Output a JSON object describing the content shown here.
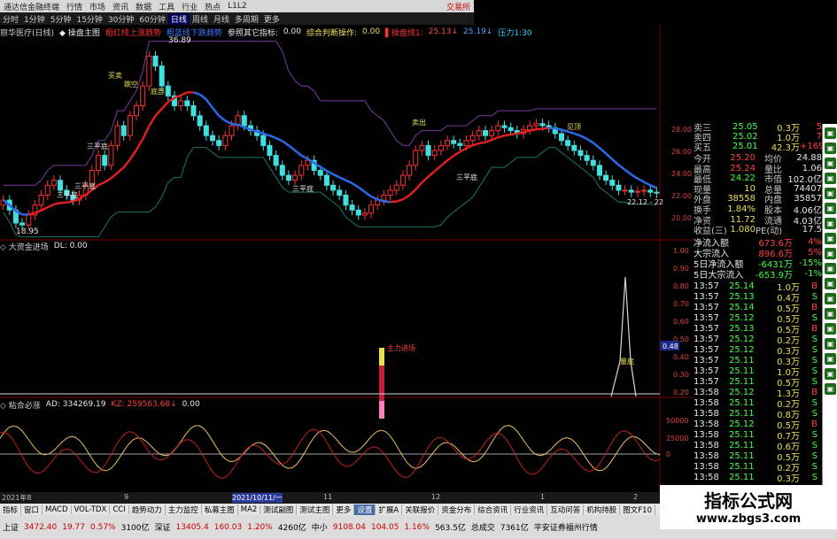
{
  "titlebar": {
    "title": "通达信金融终端",
    "menus": [
      "行情",
      "市场",
      "资讯",
      "数据",
      "工具",
      "行业",
      "热点",
      "L1L2"
    ],
    "right_label": "交易所"
  },
  "periodbar": {
    "items": [
      "分时",
      "1分钟",
      "5分钟",
      "15分钟",
      "30分钟",
      "60分钟",
      "日线",
      "周线",
      "月线",
      "多周期",
      "更多"
    ],
    "active": "日线"
  },
  "main_info": {
    "items": [
      {
        "text": "丽华医疗(日线)",
        "color": "#cfcfcf"
      },
      {
        "text": "◆ 操盘主图",
        "color": "#e8e8e8"
      },
      {
        "text": "粗红线上涨趋势",
        "color": "#ff3030"
      },
      {
        "text": "粗蓝线下跌趋势",
        "color": "#3a7cff"
      },
      {
        "text": "参照其它指标:",
        "color": "#e8e8e8"
      },
      {
        "text": "0.00",
        "color": "#e8e8e8"
      },
      {
        "text": "综合判断操作:",
        "color": "#e8e060"
      },
      {
        "text": "0.00",
        "color": "#e8e060"
      },
      {
        "text": "▌操盘线1:",
        "color": "#ff3030"
      },
      {
        "text": "25.13↓",
        "color": "#ff5050"
      },
      {
        "text": "25.19↓",
        "color": "#50a0ff"
      },
      {
        "text": "压力1:30",
        "color": "#30d0ff"
      }
    ]
  },
  "main_labels": {
    "high_price": "36.89",
    "low_price": "18.95",
    "right_note": "22.12 - 22"
  },
  "main_markers": [
    "三平底",
    "三平底",
    "三平底",
    "三平底",
    "三平底",
    "买卖",
    "跳空",
    "底部",
    "卖出",
    "见顶"
  ],
  "panel2_info": {
    "items": [
      {
        "text": "◇ 大资金进场",
        "color": "#cfcfcf"
      },
      {
        "text": "DL: 0.00",
        "color": "#e8e8e8"
      }
    ]
  },
  "panel2_labels": [
    "主力进场",
    "量底"
  ],
  "panel3_info": {
    "items": [
      {
        "text": "◇ 粘合必涨",
        "color": "#cfcfcf"
      },
      {
        "text": "AD: 334269.19",
        "color": "#e8e8e8"
      },
      {
        "text": "KZ: 259563.68↓",
        "color": "#ff4040"
      },
      {
        "text": "0.00",
        "color": "#e8e8e8"
      }
    ]
  },
  "axes": {
    "main": [
      "28.00",
      "26.00",
      "24.00",
      "22.00",
      "20.00"
    ],
    "panel2": [
      "1.00",
      "0.90",
      "0.80",
      "0.70",
      "0.60",
      "0.50",
      "0.40",
      "0.30",
      "0.20"
    ],
    "panel2_highlight": "0.48",
    "panel3": [
      "50000",
      "25000",
      "0"
    ]
  },
  "datebar": {
    "items": [
      "2021年8",
      "9",
      "2021/10/11/一",
      "11",
      "12",
      "1",
      "2"
    ]
  },
  "quote": {
    "asks": [
      {
        "label": "卖三",
        "price": "25.05",
        "vol": "0.3万",
        "flag": "5"
      },
      {
        "label": "卖四",
        "price": "25.02",
        "vol": "1.0万",
        "flag": "7"
      },
      {
        "label": "买五",
        "price": "25.01",
        "vol": "42.3万",
        "flag": "+169"
      }
    ],
    "stats": [
      {
        "k1": "今开",
        "v1": "25.20",
        "k2": "均价",
        "v2": "24.88"
      },
      {
        "k1": "最高",
        "v1": "25.24",
        "k2": "量比",
        "v2": "1.06"
      },
      {
        "k1": "最低",
        "v1": "24.22",
        "k2": "市值",
        "v2": "102.0亿"
      },
      {
        "k1": "现量",
        "v1": "10",
        "k2": "总量",
        "v2": "74407"
      },
      {
        "k1": "外盘",
        "v1": "38558",
        "k2": "内盘",
        "v2": "35857"
      },
      {
        "k1": "换手",
        "v1": "1.84%",
        "k2": "股本",
        "v2": "4.06亿"
      },
      {
        "k1": "净资",
        "v1": "11.72",
        "k2": "流通",
        "v2": "4.03亿"
      },
      {
        "k1": "收益(三)",
        "v1": "1.080",
        "k2": "PE(动)",
        "v2": "17.5"
      }
    ],
    "flows": [
      {
        "label": "净流入额",
        "value": "673.6万",
        "pct": "4%",
        "color": "#ff4040"
      },
      {
        "label": "大宗流入",
        "value": "896.6万",
        "pct": "5%",
        "color": "#ff4040"
      },
      {
        "label": "5日净流入额",
        "value": "-6431万",
        "pct": "-15%",
        "color": "#40ff40"
      },
      {
        "label": "5日大宗流入",
        "value": "-653.9万",
        "pct": "-1%",
        "color": "#40ff40"
      }
    ],
    "ticks": [
      {
        "t": "13:57",
        "p": "25.14",
        "v": "1.0万",
        "s": "B"
      },
      {
        "t": "13:57",
        "p": "25.13",
        "v": "0.4万",
        "s": "S"
      },
      {
        "t": "13:57",
        "p": "25.14",
        "v": "0.5万",
        "s": "B"
      },
      {
        "t": "13:57",
        "p": "25.12",
        "v": "0.5万",
        "s": "S"
      },
      {
        "t": "13:57",
        "p": "25.13",
        "v": "0.5万",
        "s": "B"
      },
      {
        "t": "13:57",
        "p": "25.12",
        "v": "0.2万",
        "s": "S"
      },
      {
        "t": "13:57",
        "p": "25.12",
        "v": "0.3万",
        "s": "S"
      },
      {
        "t": "13:57",
        "p": "25.11",
        "v": "0.3万",
        "s": "S"
      },
      {
        "t": "13:57",
        "p": "25.11",
        "v": "1.0万",
        "s": "S"
      },
      {
        "t": "13:57",
        "p": "25.11",
        "v": "0.5万",
        "s": "S"
      },
      {
        "t": "13:58",
        "p": "25.12",
        "v": "1.3万",
        "s": "B"
      },
      {
        "t": "13:58",
        "p": "25.11",
        "v": "0.2万",
        "s": "S"
      },
      {
        "t": "13:58",
        "p": "25.11",
        "v": "0.8万",
        "s": "S"
      },
      {
        "t": "13:58",
        "p": "25.12",
        "v": "0.5万",
        "s": "B"
      },
      {
        "t": "13:58",
        "p": "25.11",
        "v": "0.7万",
        "s": "S"
      },
      {
        "t": "13:58",
        "p": "25.11",
        "v": "0.6万",
        "s": "S"
      },
      {
        "t": "13:58",
        "p": "25.11",
        "v": "0.5万",
        "s": "S"
      },
      {
        "t": "13:58",
        "p": "25.11",
        "v": "0.2万",
        "s": "S"
      },
      {
        "t": "13:58",
        "p": "25.11",
        "v": "0.3万",
        "s": "S"
      }
    ]
  },
  "tabbar": {
    "items": [
      "指标",
      "窗口",
      "MACD",
      "VOL-TDX",
      "CCI",
      "趋势动力",
      "主力监控",
      "私募主图",
      "MA2",
      "测试副图",
      "测试主图",
      "更多",
      "设置",
      "扩展A",
      "关联报价",
      "资金分布",
      "综合资讯",
      "行业资讯",
      "互动问答",
      "机构持股",
      "图文F10"
    ],
    "active": "设置"
  },
  "statusbar": {
    "items": [
      {
        "text": "上证",
        "color": "#000"
      },
      {
        "text": "3472.40",
        "color": "#d00000"
      },
      {
        "text": "19.77",
        "color": "#d00000"
      },
      {
        "text": "0.57%",
        "color": "#d00000"
      },
      {
        "text": "3100亿",
        "color": "#000"
      },
      {
        "text": "深证",
        "color": "#000"
      },
      {
        "text": "13405.4",
        "color": "#d00000"
      },
      {
        "text": "160.03",
        "color": "#d00000"
      },
      {
        "text": "1.20%",
        "color": "#d00000"
      },
      {
        "text": "4260亿",
        "color": "#000"
      },
      {
        "text": "中小",
        "color": "#000"
      },
      {
        "text": "9108.04",
        "color": "#d00000"
      },
      {
        "text": "104.05",
        "color": "#d00000"
      },
      {
        "text": "1.16%",
        "color": "#d00000"
      },
      {
        "text": "563.5亿",
        "color": "#000"
      },
      {
        "text": "总成交",
        "color": "#000"
      },
      {
        "text": "7361亿",
        "color": "#000"
      },
      {
        "text": "平安证券福州行情",
        "color": "#000"
      }
    ]
  },
  "watermark": {
    "title": "指标公式网",
    "url": "www.zbgs3.com"
  },
  "colors": {
    "up": "#ff3030",
    "down": "#40e0e0",
    "ma_up": "#e02020",
    "ma_down": "#2a6ae8",
    "stop": "#1a7a6a",
    "resist1": "#7a3aa0",
    "resist2": "#3a7a3a",
    "ad": "#e8c060",
    "kz": "#c02020"
  }
}
